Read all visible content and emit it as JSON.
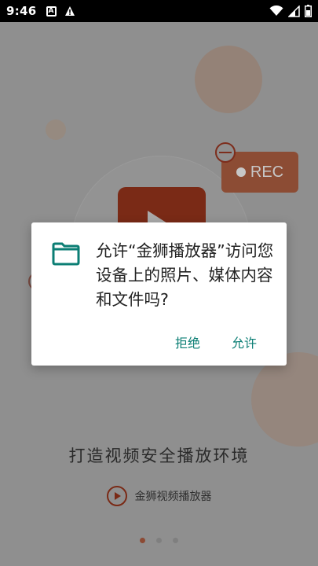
{
  "status_bar": {
    "time": "9:46",
    "left_icons": [
      "a-notification-icon",
      "warning-icon"
    ],
    "right_icons": [
      "wifi-icon",
      "signal-icon",
      "battery-icon"
    ]
  },
  "background": {
    "rec_label": "REC",
    "slogan": "打造视频安全播放环境",
    "brand_name": "金狮视频播放器",
    "page_indicator": {
      "count": 3,
      "active_index": 0
    },
    "colors": {
      "accent": "#f0522a",
      "dim_overlay": "#8f8f8f"
    }
  },
  "dialog": {
    "icon": "folder-icon",
    "message": "允许“金狮播放器”访问您设备上的照片、媒体内容和文件吗?",
    "deny_label": "拒绝",
    "allow_label": "允许",
    "button_color": "#0b7e74"
  }
}
